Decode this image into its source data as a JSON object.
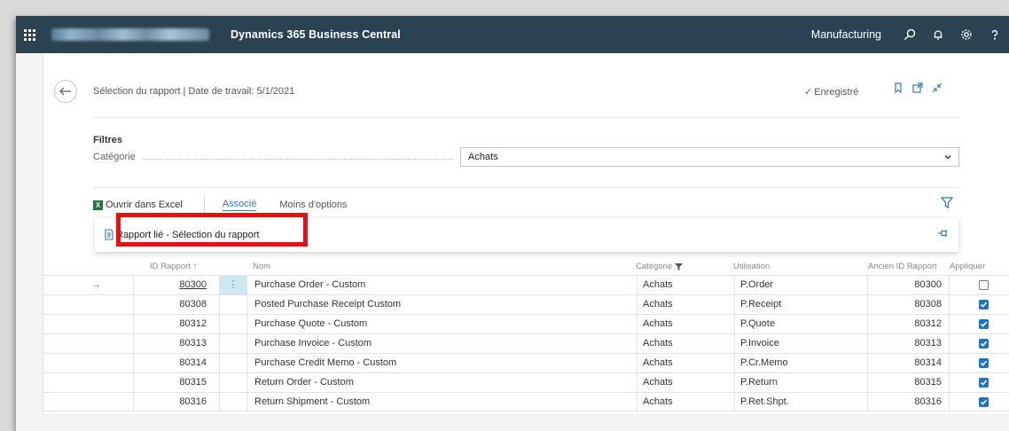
{
  "topbar": {
    "app_title": "Dynamics 365 Business Central",
    "environment": "Manufacturing",
    "icons": [
      "waffle-icon",
      "search-icon",
      "bell-icon",
      "gear-icon",
      "help-icon"
    ]
  },
  "header": {
    "caption": "Sélection du rapport | Date de travail: 5/1/2021",
    "saved_label": "Enregistré"
  },
  "filters": {
    "title": "Filtres",
    "category_label": "Catégorie",
    "category_value": "Achats"
  },
  "actions": {
    "excel": "Ouvrir dans Excel",
    "associe": "Associé",
    "moins": "Moins d'options"
  },
  "dropdown": {
    "item": "Rapport lié - Sélection du rapport"
  },
  "table": {
    "columns": {
      "id": "ID Rapport ↑",
      "nom": "Nom",
      "categorie": "Catégorie",
      "utilisation": "Utilisation",
      "ancien": "Ancien ID Rapport",
      "appliquer": "Appliquer"
    },
    "rows": [
      {
        "id": "80300",
        "nom": "Purchase Order - Custom",
        "categorie": "Achats",
        "utilisation": "P.Order",
        "ancien": "80300",
        "appliquer": false
      },
      {
        "id": "80308",
        "nom": "Posted Purchase Receipt Custom",
        "categorie": "Achats",
        "utilisation": "P.Receipt",
        "ancien": "80308",
        "appliquer": true
      },
      {
        "id": "80312",
        "nom": "Purchase Quote - Custom",
        "categorie": "Achats",
        "utilisation": "P.Quote",
        "ancien": "80312",
        "appliquer": true
      },
      {
        "id": "80313",
        "nom": "Purchase Invoice - Custom",
        "categorie": "Achats",
        "utilisation": "P.Invoice",
        "ancien": "80313",
        "appliquer": true
      },
      {
        "id": "80314",
        "nom": "Purchase Credit Memo - Custom",
        "categorie": "Achats",
        "utilisation": "P.Cr.Memo",
        "ancien": "80314",
        "appliquer": true
      },
      {
        "id": "80315",
        "nom": "Return Order - Custom",
        "categorie": "Achats",
        "utilisation": "P.Return",
        "ancien": "80315",
        "appliquer": true
      },
      {
        "id": "80316",
        "nom": "Return Shipment - Custom",
        "categorie": "Achats",
        "utilisation": "P.Ret.Shpt.",
        "ancien": "80316",
        "appliquer": true
      }
    ]
  },
  "colors": {
    "topbar": "#2b4253",
    "accent": "#2f7ab8",
    "highlight": "#e81010",
    "checkbox": "#1a73c9"
  }
}
